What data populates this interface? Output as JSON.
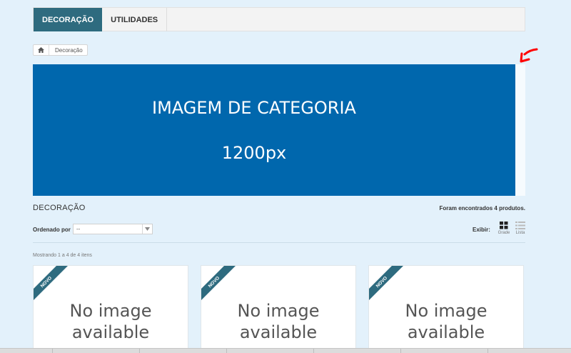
{
  "nav": {
    "tabs": [
      {
        "label": "DECORAÇÃO",
        "active": true
      },
      {
        "label": "UTILIDADES",
        "active": false
      }
    ]
  },
  "breadcrumb": {
    "home_icon": "home-icon",
    "current": "Decoração"
  },
  "banner": {
    "line1": "IMAGEM DE CATEGORIA",
    "line2": "1200px",
    "color": "#0067ad"
  },
  "annotation": {
    "arrow_color": "#ff0000"
  },
  "category": {
    "title": "DECORAÇÃO",
    "found": "Foram encontrados 4 produtos."
  },
  "sort": {
    "label": "Ordenado por",
    "selected": "--"
  },
  "view": {
    "label": "Exibir:",
    "grid_label": "Grade",
    "list_label": "Lista"
  },
  "listing": {
    "showing": "Mostrando 1 a 4 de 4 itens"
  },
  "products": [
    {
      "badge": "NOVO",
      "image_text": [
        "No image",
        "available"
      ]
    },
    {
      "badge": "NOVO",
      "image_text": [
        "No image",
        "available"
      ]
    },
    {
      "badge": "NOVO",
      "image_text": [
        "No image",
        "available"
      ]
    }
  ],
  "colors": {
    "accent": "#2e6b7f",
    "background": "#e3f1fb"
  }
}
